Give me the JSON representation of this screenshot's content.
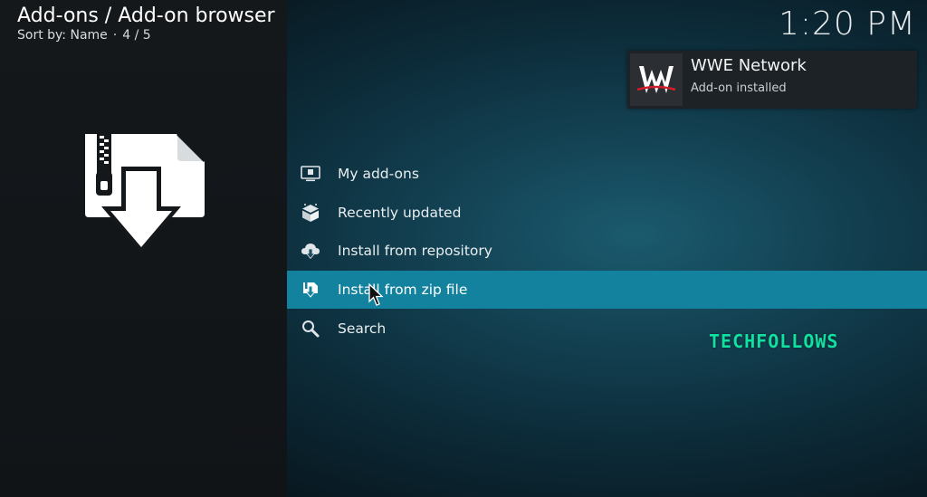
{
  "header": {
    "breadcrumb": "Add-ons / Add-on browser",
    "sort_label": "Sort by: Name",
    "position": "4 / 5"
  },
  "clock": "1:20 PM",
  "notification": {
    "title": "WWE Network",
    "message": "Add-on installed",
    "logo_icon": "wwe-logo-icon"
  },
  "menu": {
    "items": [
      {
        "label": "My add-ons",
        "icon": "monitor-box-icon",
        "selected": false
      },
      {
        "label": "Recently updated",
        "icon": "open-box-icon",
        "selected": false
      },
      {
        "label": "Install from repository",
        "icon": "cloud-download-icon",
        "selected": false
      },
      {
        "label": "Install from zip file",
        "icon": "zip-install-icon",
        "selected": true
      },
      {
        "label": "Search",
        "icon": "search-icon",
        "selected": false
      }
    ]
  },
  "colors": {
    "selected_bg": "#12829f",
    "left_panel": "#121518",
    "watermark": "#10e0a0"
  },
  "watermark": "TECHFOLLOWS"
}
